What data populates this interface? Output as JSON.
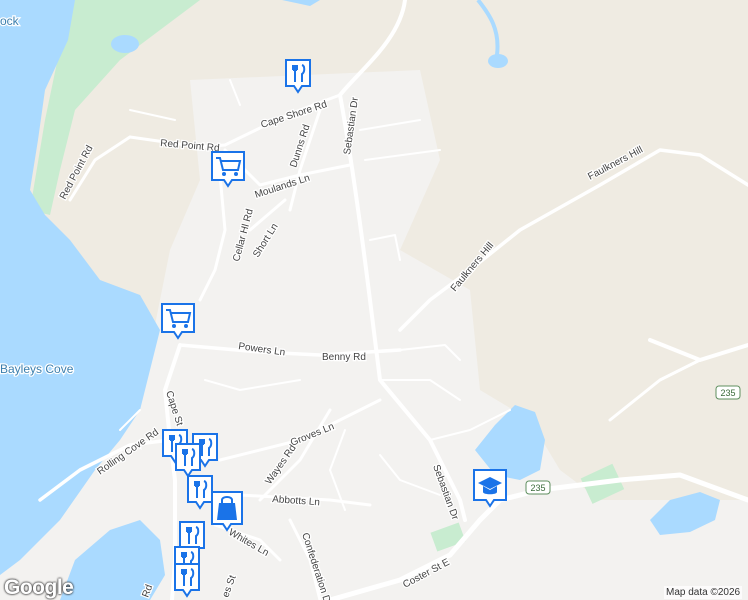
{
  "map": {
    "colors": {
      "land": "#efebe2",
      "urban": "#f3f2f0",
      "water": "#aadaff",
      "water_label": "#3b7fae",
      "park": "#c8ecd0",
      "road": "#ffffff",
      "label": "#444444",
      "marker_blue": "#1a73e8"
    },
    "labels": {
      "rock_partial": "ock",
      "bayleys_cove": "Bayleys Cove",
      "cape_shore_rd": "Cape Shore Rd",
      "red_point_rd_a": "Red Point Rd",
      "red_point_rd_b": "Red Point Rd",
      "dunns_rd": "Dunns Rd",
      "sebastian_dr_north": "Sebastian Dr",
      "sebastian_dr_south": "Sebastian Dr",
      "moulands_ln": "Moulands Ln",
      "cellar_hl_rd": "Cellar Hl Rd",
      "short_ln": "Short Ln",
      "faulkners_hill_a": "Faulkners Hill",
      "faulkners_hill_b": "Faulkners Hill",
      "powers_ln": "Powers Ln",
      "benny_rd": "Benny Rd",
      "cape_st": "Cape St",
      "rolling_cove_rd": "Rolling Cove Rd",
      "groves_ln": "Groves Ln",
      "wayes_rd": "Wayes Rd",
      "abbotts_ln": "Abbotts Ln",
      "whites_ln": "Whites Ln",
      "confederation_dr": "Confederation D",
      "coster_st_e": "Coster St E",
      "james_st_partial": "es St",
      "rd_partial": "Rd",
      "route_235_a": "235",
      "route_235_b": "235"
    },
    "markers": [
      {
        "type": "restaurant",
        "icon": "fork-knife-icon"
      },
      {
        "type": "grocery",
        "icon": "shopping-cart-icon"
      },
      {
        "type": "grocery",
        "icon": "shopping-cart-icon"
      },
      {
        "type": "restaurant",
        "icon": "fork-knife-icon"
      },
      {
        "type": "restaurant",
        "icon": "fork-knife-icon"
      },
      {
        "type": "restaurant",
        "icon": "fork-knife-icon"
      },
      {
        "type": "restaurant",
        "icon": "fork-knife-icon"
      },
      {
        "type": "shopping",
        "icon": "shopping-bag-icon"
      },
      {
        "type": "restaurant",
        "icon": "fork-knife-icon"
      },
      {
        "type": "restaurant",
        "icon": "fork-knife-icon"
      },
      {
        "type": "restaurant",
        "icon": "fork-knife-icon"
      },
      {
        "type": "school",
        "icon": "graduation-cap-icon"
      }
    ],
    "attribution": "Map data ©2026",
    "logo": "Google"
  }
}
